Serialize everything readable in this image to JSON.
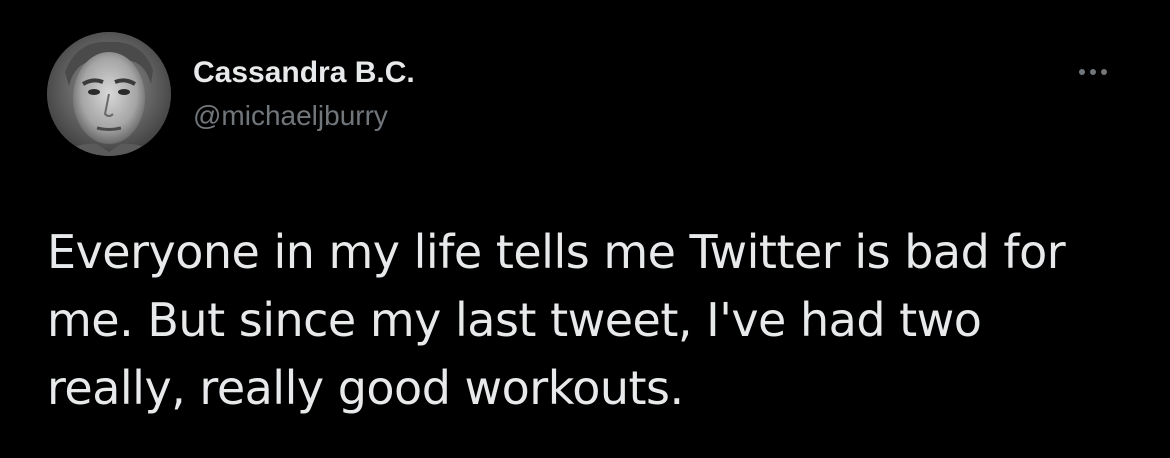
{
  "tweet": {
    "author": {
      "display_name": "Cassandra B.C.",
      "handle": "@michaeljburry",
      "avatar_icon": "profile-photo"
    },
    "more_icon": "more-horizontal-icon",
    "text_lines": [
      "Everyone in my life tells me Twitter is bad for",
      "me. But since my last tweet, I've had two",
      "really, really good workouts."
    ]
  },
  "colors": {
    "background": "#000000",
    "primary_text": "#e7e9ea",
    "secondary_text": "#71767b"
  }
}
